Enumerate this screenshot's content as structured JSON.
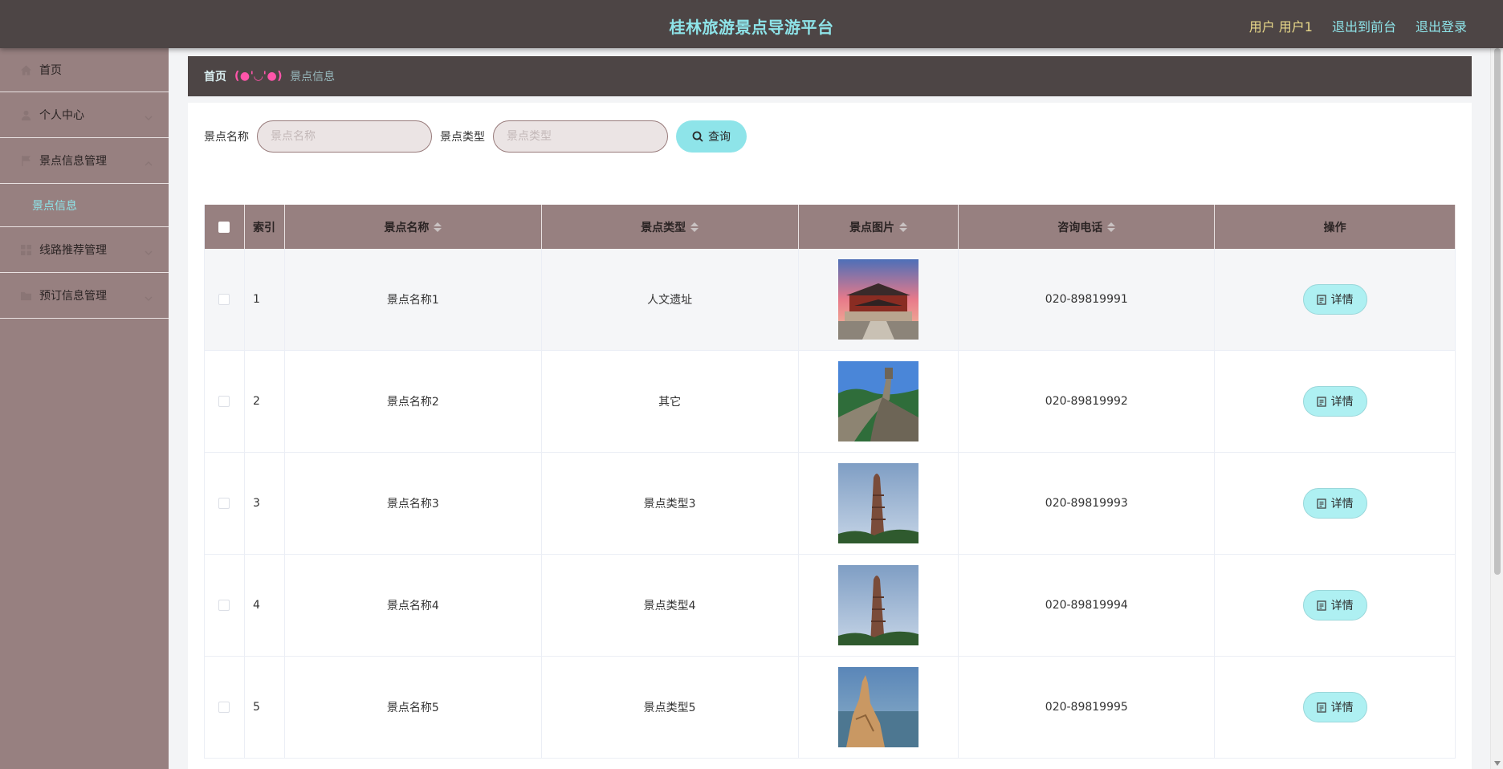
{
  "header": {
    "title": "桂林旅游景点导游平台",
    "user_label": "用户 用户1",
    "to_front_label": "退出到前台",
    "logout_label": "退出登录"
  },
  "sidebar": {
    "items": [
      {
        "label": "首页",
        "icon": "home-icon"
      },
      {
        "label": "个人中心",
        "icon": "user-icon"
      },
      {
        "label": "景点信息管理",
        "icon": "flag-icon"
      },
      {
        "label": "线路推荐管理",
        "icon": "grid-icon"
      },
      {
        "label": "预订信息管理",
        "icon": "folder-icon"
      }
    ],
    "submenu": {
      "label": "景点信息"
    }
  },
  "breadcrumb": {
    "home": "首页",
    "separator": "(●'◡'●)",
    "current": "景点信息"
  },
  "search": {
    "name_label": "景点名称",
    "name_placeholder": "景点名称",
    "type_label": "景点类型",
    "type_placeholder": "景点类型",
    "query_label": "查询"
  },
  "table": {
    "columns": {
      "index": "索引",
      "name": "景点名称",
      "type": "景点类型",
      "image": "景点图片",
      "phone": "咨询电话",
      "op": "操作"
    },
    "detail_label": "详情",
    "rows": [
      {
        "index": "1",
        "name": "景点名称1",
        "type": "人文遗址",
        "phone": "020-89819991",
        "image": "palace"
      },
      {
        "index": "2",
        "name": "景点名称2",
        "type": "其它",
        "phone": "020-89819992",
        "image": "great-wall"
      },
      {
        "index": "3",
        "name": "景点名称3",
        "type": "景点类型3",
        "phone": "020-89819993",
        "image": "tower"
      },
      {
        "index": "4",
        "name": "景点名称4",
        "type": "景点类型4",
        "phone": "020-89819994",
        "image": "tower"
      },
      {
        "index": "5",
        "name": "景点名称5",
        "type": "景点类型5",
        "phone": "020-89819995",
        "image": "cliff"
      }
    ]
  },
  "colors": {
    "header_bg": "#4d4545",
    "sidebar_bg": "#978080",
    "accent": "#8ee4e9",
    "user_color": "#e9d98a"
  }
}
